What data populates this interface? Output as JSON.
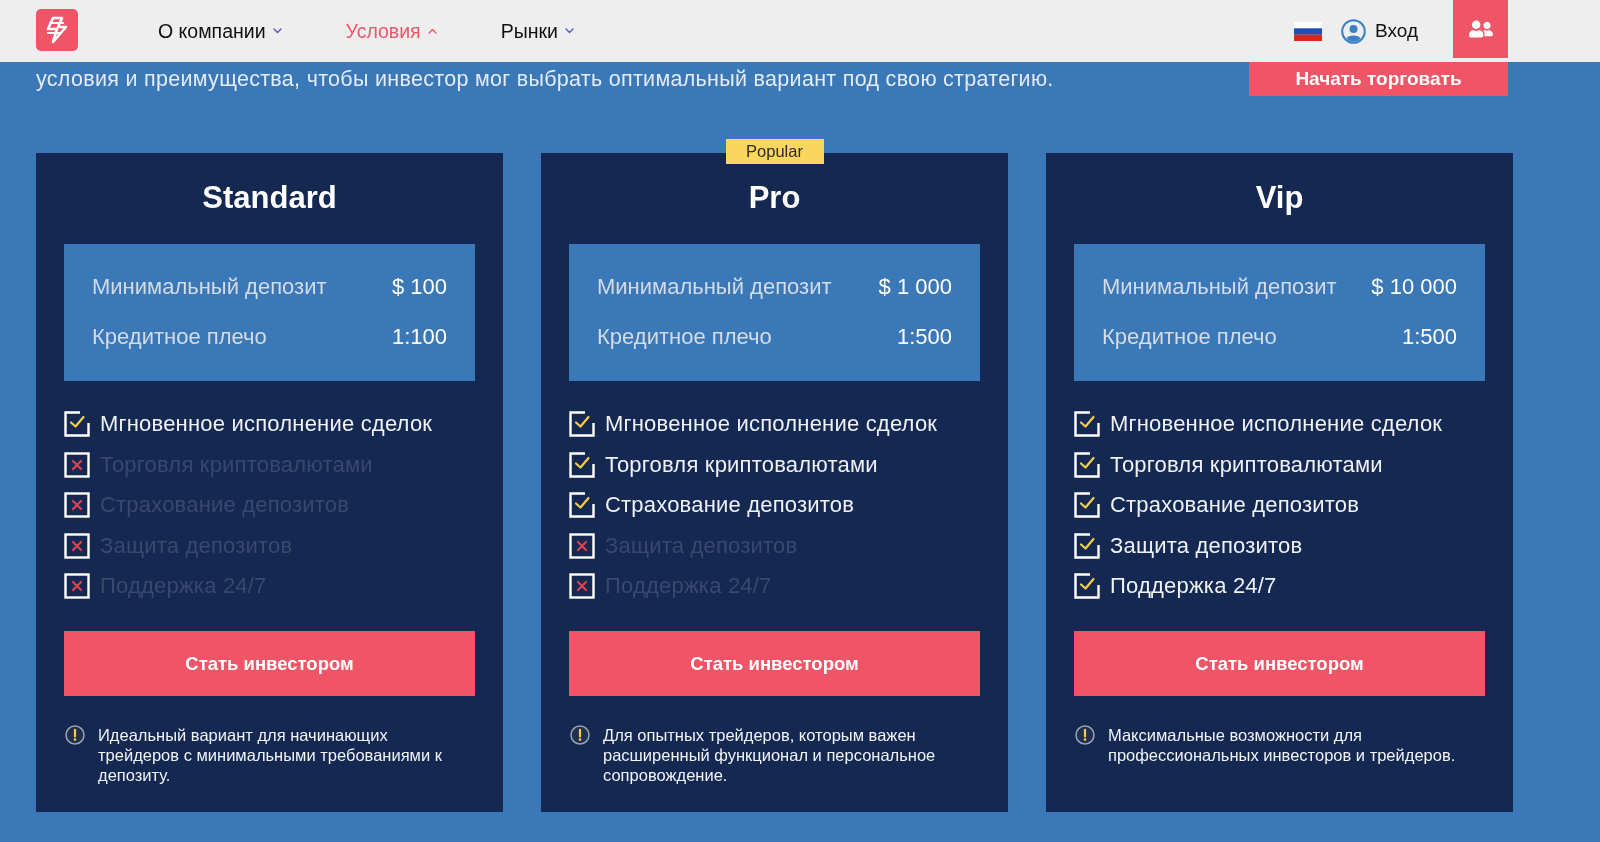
{
  "header": {
    "nav": [
      {
        "label": "О компании",
        "expanded": false
      },
      {
        "label": "Условия",
        "expanded": true
      },
      {
        "label": "Рынки",
        "expanded": false
      }
    ],
    "login": "Вход"
  },
  "intro": {
    "text": "условия и преимущества, чтобы инвестор мог выбрать оптимальный вариант под свою стратегию.",
    "cta": "Начать торговать"
  },
  "plans": [
    {
      "name": "Standard",
      "terms": [
        {
          "label": "Минимальный депозит",
          "value": "$ 100"
        },
        {
          "label": "Кредитное плечо",
          "value": "1:100"
        }
      ],
      "features": [
        {
          "label": "Мгновенное исполнение сделок",
          "checked": true
        },
        {
          "label": "Торговля криптовалютами",
          "checked": false
        },
        {
          "label": "Страхование депозитов",
          "checked": false
        },
        {
          "label": "Защита депозитов",
          "checked": false
        },
        {
          "label": "Поддержка 24/7",
          "checked": false
        }
      ],
      "button": "Стать инвестором",
      "note": "Идеальный вариант для начинающих трейдеров с минимальными требованиями к депозиту."
    },
    {
      "name": "Pro",
      "badge": "Popular",
      "terms": [
        {
          "label": "Минимальный депозит",
          "value": "$ 1 000"
        },
        {
          "label": "Кредитное плечо",
          "value": "1:500"
        }
      ],
      "features": [
        {
          "label": "Мгновенное исполнение сделок",
          "checked": true
        },
        {
          "label": "Торговля криптовалютами",
          "checked": true
        },
        {
          "label": "Страхование депозитов",
          "checked": true
        },
        {
          "label": "Защита депозитов",
          "checked": false
        },
        {
          "label": "Поддержка 24/7",
          "checked": false
        }
      ],
      "button": "Стать инвестором",
      "note": "Для опытных трейдеров, которым важен расширенный функционал и персональное сопровождение."
    },
    {
      "name": "Vip",
      "terms": [
        {
          "label": "Минимальный депозит",
          "value": "$ 10 000"
        },
        {
          "label": "Кредитное плечо",
          "value": "1:500"
        }
      ],
      "features": [
        {
          "label": "Мгновенное исполнение сделок",
          "checked": true
        },
        {
          "label": "Торговля криптовалютами",
          "checked": true
        },
        {
          "label": "Страхование депозитов",
          "checked": true
        },
        {
          "label": "Защита депозитов",
          "checked": true
        },
        {
          "label": "Поддержка 24/7",
          "checked": true
        }
      ],
      "button": "Стать инвестором",
      "note": "Максимальные возможности для профессиональных инвесторов и трейдеров."
    }
  ]
}
